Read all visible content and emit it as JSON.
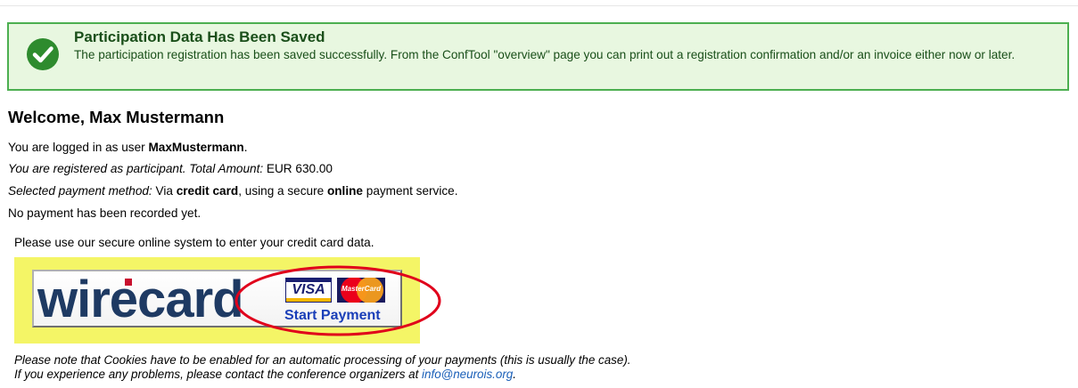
{
  "success": {
    "title": "Participation Data Has Been Saved",
    "text": "The participation registration has been saved successfully. From the ConfTool \"overview\" page you can print out a registration confirmation and/or an invoice either now or later.",
    "icon": "check-circle-icon",
    "color": "#4caf50"
  },
  "welcome": {
    "heading": "Welcome, Max Mustermann"
  },
  "info": {
    "logged_in_prefix": "You are logged in as user ",
    "username": "MaxMustermann",
    "logged_in_suffix": ".",
    "registered_text": "You are registered as participant. Total Amount:",
    "amount": " EUR 630.00",
    "payment_method_label": "Selected payment method:",
    "payment_via": " Via ",
    "payment_credit_card": "credit card",
    "payment_using": ", using a secure ",
    "payment_online": "online",
    "payment_service": " payment service.",
    "no_payment": "No payment has been recorded yet.",
    "use_system": "Please use our secure online system to enter your credit card data."
  },
  "payment_button": {
    "logo_text": "wirecard",
    "visa_label": "VISA",
    "mastercard_label": "MasterCard",
    "start_label": "Start Payment",
    "frame_color": "#f4f566",
    "highlight_color": "#e0001b"
  },
  "notes": {
    "line1": "Please note that Cookies have to be enabled for an automatic processing of your payments (this is usually the case).",
    "line2_prefix": "If you experience any problems, please contact the conference organizers at ",
    "email": "info@neurois.org",
    "line2_suffix": "."
  }
}
